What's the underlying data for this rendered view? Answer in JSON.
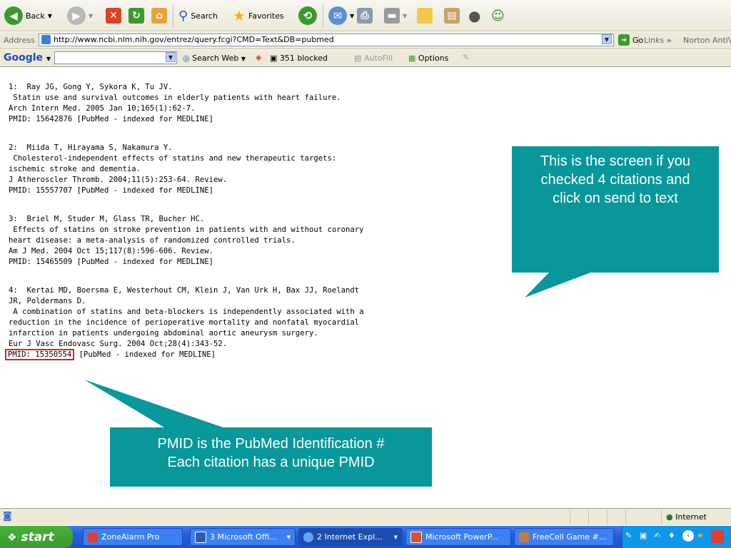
{
  "toolbar": {
    "back": "Back",
    "search": "Search",
    "favorites": "Favorites"
  },
  "address": {
    "label": "Address",
    "url": "http://www.ncbi.nlm.nih.gov/entrez/query.fcgi?CMD=Text&DB=pubmed",
    "go": "Go",
    "links": "Links",
    "chevron": "»",
    "norton": "Norton AntiVi"
  },
  "google": {
    "logo": "Google",
    "search_web": "Search Web",
    "blocked": "351 blocked",
    "autofill": "AutoFill",
    "options": "Options"
  },
  "citations": [
    {
      "lines": [
        "1:  Ray JG, Gong Y, Sykora K, Tu JV.",
        " Statin use and survival outcomes in elderly patients with heart failure.",
        "Arch Intern Med. 2005 Jan 10;165(1):62-7."
      ],
      "pmid": "PMID: 15642876",
      "status": " [PubMed - indexed for MEDLINE]"
    },
    {
      "lines": [
        "2:  Miida T, Hirayama S, Nakamura Y.",
        " Cholesterol-independent effects of statins and new therapeutic targets:",
        "ischemic stroke and dementia.",
        "J Atheroscler Thromb. 2004;11(5):253-64. Review."
      ],
      "pmid": "PMID: 15557707",
      "status": " [PubMed - indexed for MEDLINE]"
    },
    {
      "lines": [
        "3:  Briel M, Studer M, Glass TR, Bucher HC.",
        " Effects of statins on stroke prevention in patients with and without coronary",
        "heart disease: a meta-analysis of randomized controlled trials.",
        "Am J Med. 2004 Oct 15;117(8):596-606. Review."
      ],
      "pmid": "PMID: 15465509",
      "status": " [PubMed - indexed for MEDLINE]"
    },
    {
      "lines": [
        "4:  Kertai MD, Boersma E, Westerhout CM, Klein J, Van Urk H, Bax JJ, Roelandt",
        "JR, Poldermans D.",
        " A combination of statins and beta-blockers is independently associated with a",
        "reduction in the incidence of perioperative mortality and nonfatal myocardial",
        "infarction in patients undergoing abdominal aortic aneurysm surgery.",
        "Eur J Vasc Endovasc Surg. 2004 Oct;28(4):343-52."
      ],
      "pmid": "PMID: 15350554",
      "status": " [PubMed - indexed for MEDLINE]"
    }
  ],
  "callouts": {
    "top": [
      "This is the screen if you",
      "checked 4 citations and",
      "click on send to text"
    ],
    "bottom": [
      "PMID is the PubMed Identification #",
      "Each citation has a unique PMID"
    ]
  },
  "status": {
    "zone": "Internet"
  },
  "taskbar": {
    "start": "start",
    "tasks": [
      "ZoneAlarm Pro",
      "3 Microsoft Offi...",
      "2 Internet Expl...",
      "Microsoft PowerP...",
      "FreeCell Game #..."
    ]
  },
  "colors": {
    "callout": "#08979a",
    "highlight": "#e0201a",
    "taskbar": "#245edb",
    "start": "#3a9a2d"
  }
}
